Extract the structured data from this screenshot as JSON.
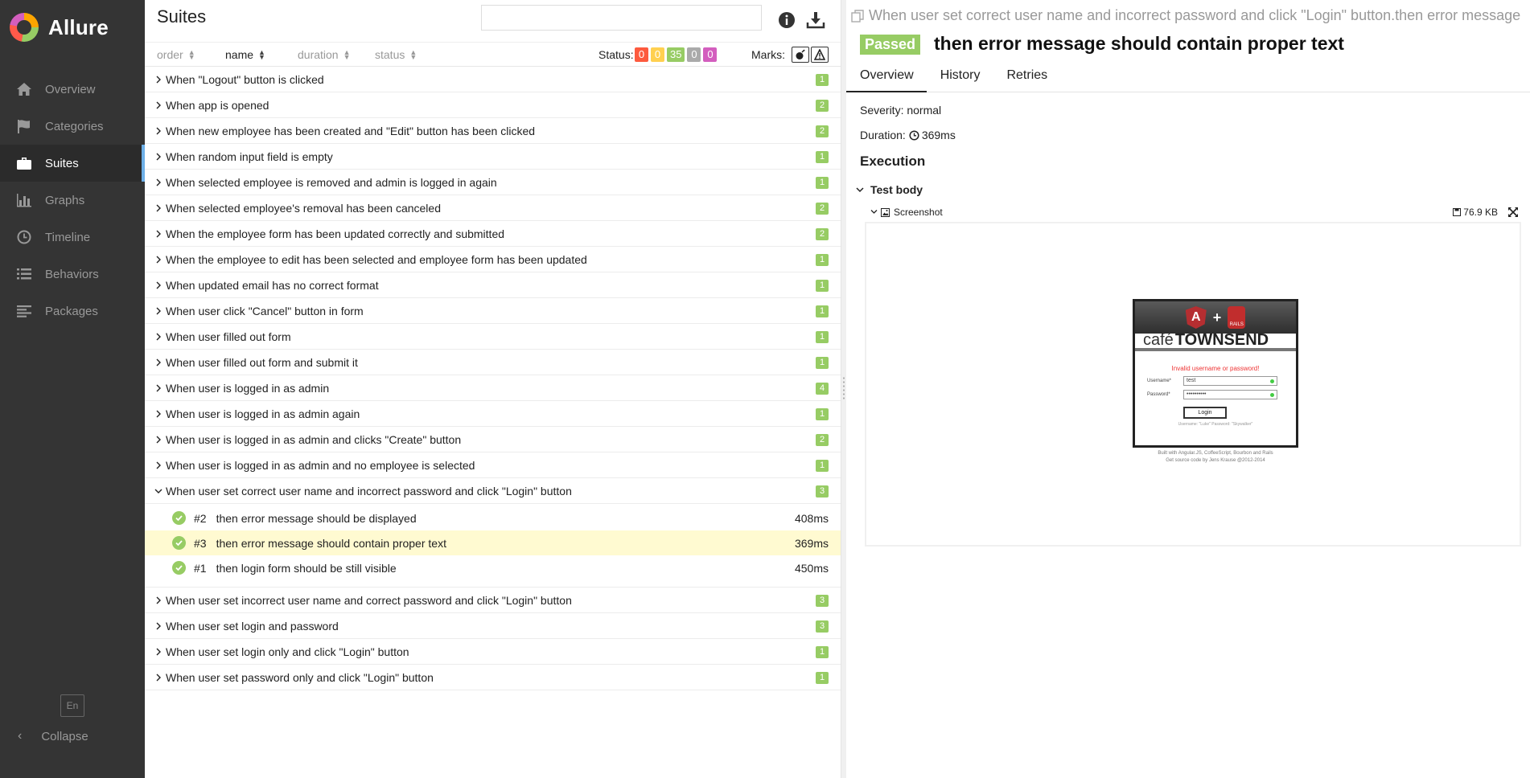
{
  "sidebar": {
    "brand": "Allure",
    "items": [
      {
        "label": "Overview",
        "icon": "home-icon",
        "active": false
      },
      {
        "label": "Categories",
        "icon": "flag-icon",
        "active": false
      },
      {
        "label": "Suites",
        "icon": "briefcase-icon",
        "active": true
      },
      {
        "label": "Graphs",
        "icon": "bar-chart-icon",
        "active": false
      },
      {
        "label": "Timeline",
        "icon": "clock-icon",
        "active": false
      },
      {
        "label": "Behaviors",
        "icon": "list-icon",
        "active": false
      },
      {
        "label": "Packages",
        "icon": "align-left-icon",
        "active": false
      }
    ],
    "language": "En",
    "collapse_label": "Collapse"
  },
  "suites": {
    "title": "Suites",
    "search_value": "",
    "sort": {
      "order": "order",
      "name": "name",
      "duration": "duration",
      "status": "status"
    },
    "status_label": "Status:",
    "counters": [
      {
        "value": "0",
        "color": "#fd5a3e"
      },
      {
        "value": "0",
        "color": "#ffd050"
      },
      {
        "value": "35",
        "color": "#97cc64"
      },
      {
        "value": "0",
        "color": "#aaaaaa"
      },
      {
        "value": "0",
        "color": "#d35ebe"
      }
    ],
    "marks_label": "Marks:",
    "rows_before": [
      {
        "name": "When \"Logout\" button is clicked",
        "count": "1"
      },
      {
        "name": "When app is opened",
        "count": "2"
      },
      {
        "name": "When new employee has been created and \"Edit\" button has been clicked",
        "count": "2"
      },
      {
        "name": "When random input field is empty",
        "count": "1"
      },
      {
        "name": "When selected employee is removed and admin is logged in again",
        "count": "1"
      },
      {
        "name": "When selected employee's removal has been canceled",
        "count": "2"
      },
      {
        "name": "When the employee form has been updated correctly and submitted",
        "count": "2"
      },
      {
        "name": "When the employee to edit has been selected and employee form has been updated",
        "count": "1"
      },
      {
        "name": "When updated email has no correct format",
        "count": "1"
      },
      {
        "name": "When user click \"Cancel\" button in form",
        "count": "1"
      },
      {
        "name": "When user filled out form",
        "count": "1"
      },
      {
        "name": "When user filled out form and submit it",
        "count": "1"
      },
      {
        "name": "When user is logged in as admin",
        "count": "4"
      },
      {
        "name": "When user is logged in as admin again",
        "count": "1"
      },
      {
        "name": "When user is logged in as admin and clicks \"Create\" button",
        "count": "2"
      },
      {
        "name": "When user is logged in as admin and no employee is selected",
        "count": "1"
      }
    ],
    "expanded_row": {
      "name": "When user set correct user name and incorrect password and click \"Login\" button",
      "count": "3"
    },
    "sub_rows": [
      {
        "num": "#2",
        "name": "then error message should be displayed",
        "duration": "408ms",
        "selected": false
      },
      {
        "num": "#3",
        "name": "then error message should contain proper text",
        "duration": "369ms",
        "selected": true
      },
      {
        "num": "#1",
        "name": "then login form should be still visible",
        "duration": "450ms",
        "selected": false
      }
    ],
    "rows_after": [
      {
        "name": "When user set incorrect user name and correct password and click \"Login\" button",
        "count": "3"
      },
      {
        "name": "When user set login and password",
        "count": "3"
      },
      {
        "name": "When user set login only and click \"Login\" button",
        "count": "1"
      },
      {
        "name": "When user set password only and click \"Login\" button",
        "count": "1"
      }
    ]
  },
  "details": {
    "breadcrumb": "When user set correct user name and incorrect password and click \"Login\" button.then error message should contain proper text",
    "status": "Passed",
    "title": "then error message should contain proper text",
    "tabs": [
      "Overview",
      "History",
      "Retries"
    ],
    "severity": "Severity: normal",
    "duration_label": "Duration:",
    "duration_value": "369ms",
    "execution": "Execution",
    "test_body": "Test body",
    "attachment_name": "Screenshot",
    "attachment_size": "76.9 KB",
    "screenshot": {
      "cafe_prefix": "café",
      "cafe_name": "TOWNSEND",
      "error": "Invalid username or password!",
      "username_label": "Username*",
      "username_value": "test",
      "password_label": "Password*",
      "password_value": "••••••••••",
      "login_button": "Login",
      "hint": "Username: \"Luke\" Password: \"Skywalker\"",
      "footer1": "Built with Angular.JS, CoffeeScript, Bourbon and Rails",
      "footer2": "Get source code by Jens Krause @2012-2014"
    }
  }
}
